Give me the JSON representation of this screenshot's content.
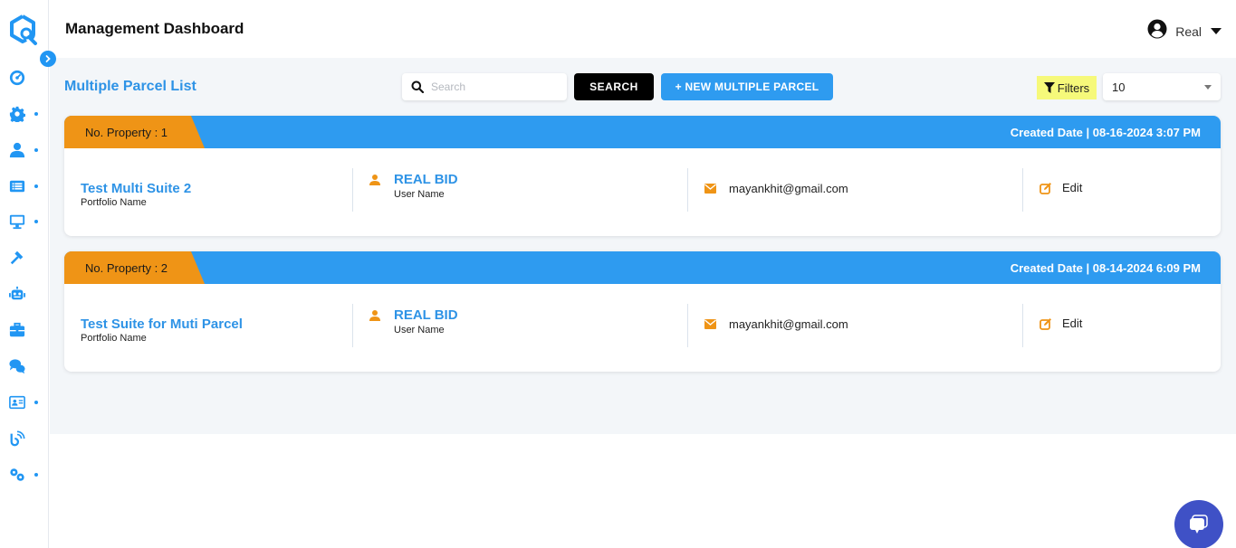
{
  "header": {
    "title": "Management Dashboard",
    "user": {
      "name": "Real",
      "icon": "user-circle-icon"
    }
  },
  "sidebar": {
    "logo": "logo-icon",
    "items": [
      {
        "name": "dashboard",
        "icon": "gauge-icon",
        "has_submenu": false
      },
      {
        "name": "settings",
        "icon": "gear-icon",
        "has_submenu": true
      },
      {
        "name": "users",
        "icon": "user-icon",
        "has_submenu": true
      },
      {
        "name": "list",
        "icon": "list-icon",
        "has_submenu": true
      },
      {
        "name": "monitor",
        "icon": "monitor-icon",
        "has_submenu": true
      },
      {
        "name": "auction",
        "icon": "gavel-icon",
        "has_submenu": false
      },
      {
        "name": "bot",
        "icon": "robot-icon",
        "has_submenu": false
      },
      {
        "name": "portfolio",
        "icon": "briefcase-icon",
        "has_submenu": false
      },
      {
        "name": "chat",
        "icon": "comments-icon",
        "has_submenu": false
      },
      {
        "name": "contacts",
        "icon": "id-card-icon",
        "has_submenu": true
      },
      {
        "name": "broadcast",
        "icon": "signal-icon",
        "has_submenu": false
      },
      {
        "name": "config",
        "icon": "gears-icon",
        "has_submenu": true
      }
    ]
  },
  "toolbar": {
    "section_title": "Multiple Parcel List",
    "search_placeholder": "Search",
    "search_value": "",
    "search_button": "SEARCH",
    "new_button": "+ NEW MULTIPLE PARCEL",
    "filters_button": "Filters",
    "page_size": "10"
  },
  "parcels": [
    {
      "property_label": "No. Property : 1",
      "created_date": "Created Date | 08-16-2024 3:07 PM",
      "portfolio_name": "Test Multi Suite 2",
      "portfolio_label": "Portfolio Name",
      "user_name": "REAL BID",
      "user_label": "User Name",
      "email": "mayankhit@gmail.com",
      "edit_label": "Edit"
    },
    {
      "property_label": "No. Property : 2",
      "created_date": "Created Date | 08-14-2024 6:09 PM",
      "portfolio_name": "Test Suite for Muti Parcel",
      "portfolio_label": "Portfolio Name",
      "user_name": "REAL BID",
      "user_label": "User Name",
      "email": "mayankhit@gmail.com",
      "edit_label": "Edit"
    }
  ],
  "colors": {
    "primary": "#2e9bf0",
    "accent_orange": "#ef9416",
    "filters_highlight": "#f6f97a",
    "chat_fab": "#3f51c6"
  }
}
